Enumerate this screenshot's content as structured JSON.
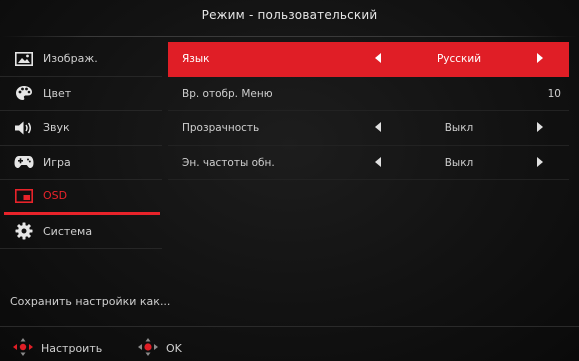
{
  "header": {
    "title": "Режим - пользовательский"
  },
  "sidebar": {
    "items": [
      {
        "label": "Изображ.",
        "icon": "image-icon"
      },
      {
        "label": "Цвет",
        "icon": "palette-icon"
      },
      {
        "label": "Звук",
        "icon": "speaker-icon"
      },
      {
        "label": "Игра",
        "icon": "gamepad-icon"
      },
      {
        "label": "OSD",
        "icon": "osd-icon",
        "active": true
      },
      {
        "label": "Система",
        "icon": "gear-icon"
      }
    ],
    "save_label": "Сохранить настройки как..."
  },
  "settings": [
    {
      "label": "Язык",
      "value": "Русский",
      "selected": true
    },
    {
      "label": "Вр. отобр. Меню",
      "value": "10"
    },
    {
      "label": "Прозрачность",
      "value": "Выкл"
    },
    {
      "label": "Эн. частоты обн.",
      "value": "Выкл"
    }
  ],
  "footer": {
    "adjust_label": "Настроить",
    "ok_label": "OK"
  },
  "colors": {
    "accent": "#e01e26",
    "background": "#121212",
    "text": "#cfcfcf"
  }
}
